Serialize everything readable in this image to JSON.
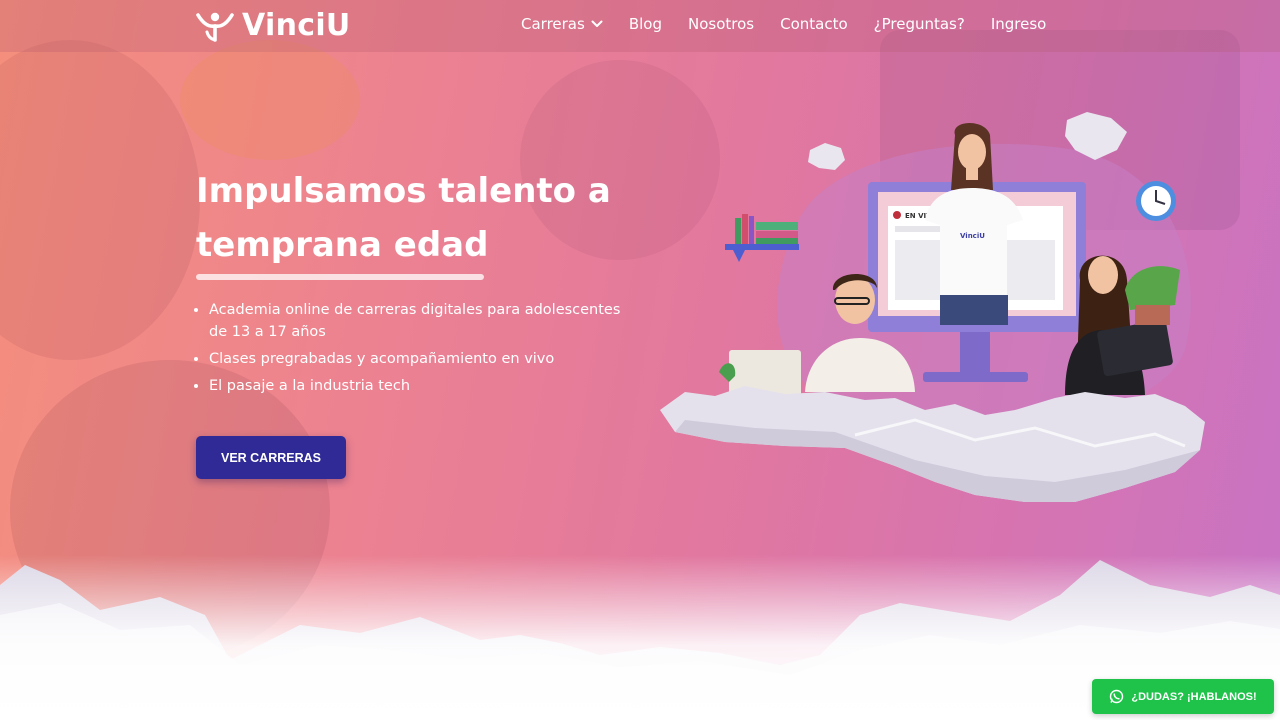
{
  "brand": {
    "name": "VinciU"
  },
  "nav": {
    "items": [
      {
        "label": "Carreras",
        "has_dropdown": true,
        "icon": "chevron-down-icon"
      },
      {
        "label": "Blog"
      },
      {
        "label": "Nosotros"
      },
      {
        "label": "Contacto"
      },
      {
        "label": "¿Preguntas?"
      },
      {
        "label": "Ingreso"
      }
    ]
  },
  "hero": {
    "title_line1": "Impulsamos talento a",
    "title_line2": "temprana edad",
    "bullets": [
      "Academia online de carreras digitales para adolescentes de 13 a 17 años",
      "Clases pregrabadas y acompañamiento en vivo",
      "El pasaje a la industria tech"
    ],
    "cta_label": "VER CARRERAS"
  },
  "illustration": {
    "live_badge": "EN VIVO",
    "shirt_logo": "VinciU"
  },
  "whatsapp": {
    "label": "¿DUDAS? ¡HABLANOS!",
    "icon": "whatsapp-icon"
  },
  "colors": {
    "cta_bg": "#2f2a96",
    "whatsapp_bg": "#1fc34a",
    "gradient_start": "#f58f7c",
    "gradient_end": "#c873c4"
  }
}
